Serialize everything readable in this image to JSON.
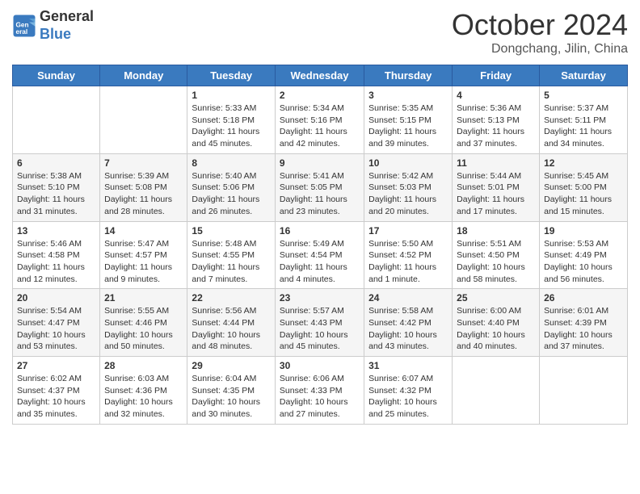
{
  "header": {
    "logo_line1": "General",
    "logo_line2": "Blue",
    "month": "October 2024",
    "location": "Dongchang, Jilin, China"
  },
  "weekdays": [
    "Sunday",
    "Monday",
    "Tuesday",
    "Wednesday",
    "Thursday",
    "Friday",
    "Saturday"
  ],
  "weeks": [
    [
      {
        "day": "",
        "info": ""
      },
      {
        "day": "",
        "info": ""
      },
      {
        "day": "1",
        "info": "Sunrise: 5:33 AM\nSunset: 5:18 PM\nDaylight: 11 hours\nand 45 minutes."
      },
      {
        "day": "2",
        "info": "Sunrise: 5:34 AM\nSunset: 5:16 PM\nDaylight: 11 hours\nand 42 minutes."
      },
      {
        "day": "3",
        "info": "Sunrise: 5:35 AM\nSunset: 5:15 PM\nDaylight: 11 hours\nand 39 minutes."
      },
      {
        "day": "4",
        "info": "Sunrise: 5:36 AM\nSunset: 5:13 PM\nDaylight: 11 hours\nand 37 minutes."
      },
      {
        "day": "5",
        "info": "Sunrise: 5:37 AM\nSunset: 5:11 PM\nDaylight: 11 hours\nand 34 minutes."
      }
    ],
    [
      {
        "day": "6",
        "info": "Sunrise: 5:38 AM\nSunset: 5:10 PM\nDaylight: 11 hours\nand 31 minutes."
      },
      {
        "day": "7",
        "info": "Sunrise: 5:39 AM\nSunset: 5:08 PM\nDaylight: 11 hours\nand 28 minutes."
      },
      {
        "day": "8",
        "info": "Sunrise: 5:40 AM\nSunset: 5:06 PM\nDaylight: 11 hours\nand 26 minutes."
      },
      {
        "day": "9",
        "info": "Sunrise: 5:41 AM\nSunset: 5:05 PM\nDaylight: 11 hours\nand 23 minutes."
      },
      {
        "day": "10",
        "info": "Sunrise: 5:42 AM\nSunset: 5:03 PM\nDaylight: 11 hours\nand 20 minutes."
      },
      {
        "day": "11",
        "info": "Sunrise: 5:44 AM\nSunset: 5:01 PM\nDaylight: 11 hours\nand 17 minutes."
      },
      {
        "day": "12",
        "info": "Sunrise: 5:45 AM\nSunset: 5:00 PM\nDaylight: 11 hours\nand 15 minutes."
      }
    ],
    [
      {
        "day": "13",
        "info": "Sunrise: 5:46 AM\nSunset: 4:58 PM\nDaylight: 11 hours\nand 12 minutes."
      },
      {
        "day": "14",
        "info": "Sunrise: 5:47 AM\nSunset: 4:57 PM\nDaylight: 11 hours\nand 9 minutes."
      },
      {
        "day": "15",
        "info": "Sunrise: 5:48 AM\nSunset: 4:55 PM\nDaylight: 11 hours\nand 7 minutes."
      },
      {
        "day": "16",
        "info": "Sunrise: 5:49 AM\nSunset: 4:54 PM\nDaylight: 11 hours\nand 4 minutes."
      },
      {
        "day": "17",
        "info": "Sunrise: 5:50 AM\nSunset: 4:52 PM\nDaylight: 11 hours\nand 1 minute."
      },
      {
        "day": "18",
        "info": "Sunrise: 5:51 AM\nSunset: 4:50 PM\nDaylight: 10 hours\nand 58 minutes."
      },
      {
        "day": "19",
        "info": "Sunrise: 5:53 AM\nSunset: 4:49 PM\nDaylight: 10 hours\nand 56 minutes."
      }
    ],
    [
      {
        "day": "20",
        "info": "Sunrise: 5:54 AM\nSunset: 4:47 PM\nDaylight: 10 hours\nand 53 minutes."
      },
      {
        "day": "21",
        "info": "Sunrise: 5:55 AM\nSunset: 4:46 PM\nDaylight: 10 hours\nand 50 minutes."
      },
      {
        "day": "22",
        "info": "Sunrise: 5:56 AM\nSunset: 4:44 PM\nDaylight: 10 hours\nand 48 minutes."
      },
      {
        "day": "23",
        "info": "Sunrise: 5:57 AM\nSunset: 4:43 PM\nDaylight: 10 hours\nand 45 minutes."
      },
      {
        "day": "24",
        "info": "Sunrise: 5:58 AM\nSunset: 4:42 PM\nDaylight: 10 hours\nand 43 minutes."
      },
      {
        "day": "25",
        "info": "Sunrise: 6:00 AM\nSunset: 4:40 PM\nDaylight: 10 hours\nand 40 minutes."
      },
      {
        "day": "26",
        "info": "Sunrise: 6:01 AM\nSunset: 4:39 PM\nDaylight: 10 hours\nand 37 minutes."
      }
    ],
    [
      {
        "day": "27",
        "info": "Sunrise: 6:02 AM\nSunset: 4:37 PM\nDaylight: 10 hours\nand 35 minutes."
      },
      {
        "day": "28",
        "info": "Sunrise: 6:03 AM\nSunset: 4:36 PM\nDaylight: 10 hours\nand 32 minutes."
      },
      {
        "day": "29",
        "info": "Sunrise: 6:04 AM\nSunset: 4:35 PM\nDaylight: 10 hours\nand 30 minutes."
      },
      {
        "day": "30",
        "info": "Sunrise: 6:06 AM\nSunset: 4:33 PM\nDaylight: 10 hours\nand 27 minutes."
      },
      {
        "day": "31",
        "info": "Sunrise: 6:07 AM\nSunset: 4:32 PM\nDaylight: 10 hours\nand 25 minutes."
      },
      {
        "day": "",
        "info": ""
      },
      {
        "day": "",
        "info": ""
      }
    ]
  ]
}
